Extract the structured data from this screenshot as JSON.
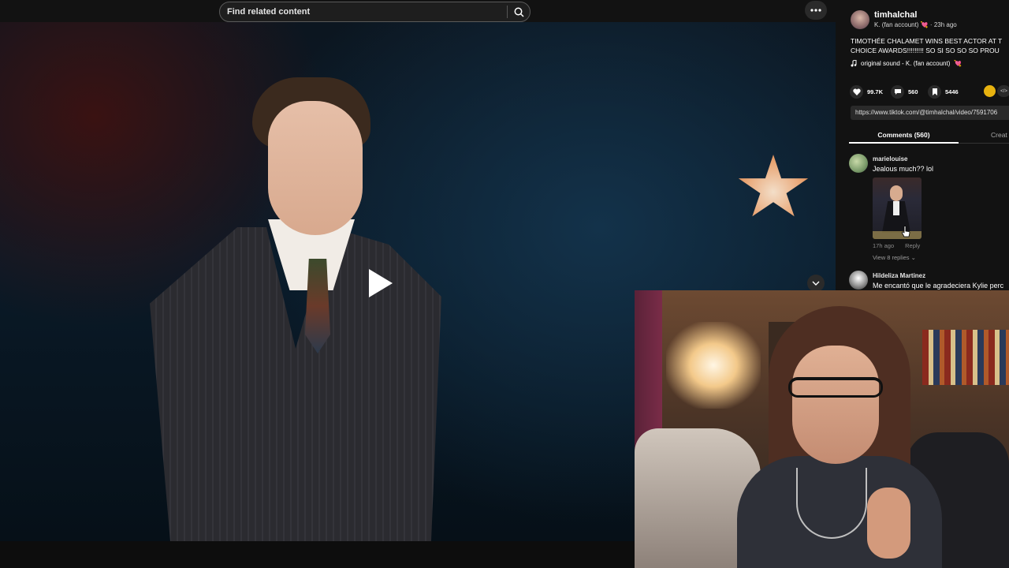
{
  "search": {
    "placeholder": "Find related content"
  },
  "post": {
    "author": "timhalchal",
    "author_display": "K. (fan account)",
    "author_emoji": "💘",
    "posted": "23h ago",
    "caption_line1": "TIMOTHÉE CHALAMET WINS BEST ACTOR AT T",
    "caption_line2": "CHOICE AWARDS!!!!!!!!! SO SI SO SO SO PROU",
    "sound": "original sound - K. (fan account)",
    "sound_emoji": "💘"
  },
  "stats": {
    "likes": "99.7K",
    "comments": "560",
    "saves": "5446"
  },
  "link": "https://www.tiktok.com/@timhalchal/video/7591706",
  "tabs": {
    "comments": "Comments (560)",
    "creator": "Creat"
  },
  "comments": [
    {
      "user": "marielouise",
      "text": "Jealous much?? lol",
      "age": "17h ago",
      "reply": "Reply",
      "view_replies": "View 8 replies"
    },
    {
      "user": "Hildeliza Martinez",
      "text": "Me encantó que le agradeciera Kylie perc"
    }
  ],
  "icons": {
    "search": "search-icon",
    "more": "more-icon",
    "play": "play-icon",
    "chevron": "chevron-down-icon",
    "like": "heart-icon",
    "comment": "comment-icon",
    "save": "bookmark-icon",
    "music": "music-note-icon"
  },
  "colors": {
    "accent_heart": "#e8456f",
    "background": "#121212",
    "share": "#e7b20f"
  }
}
